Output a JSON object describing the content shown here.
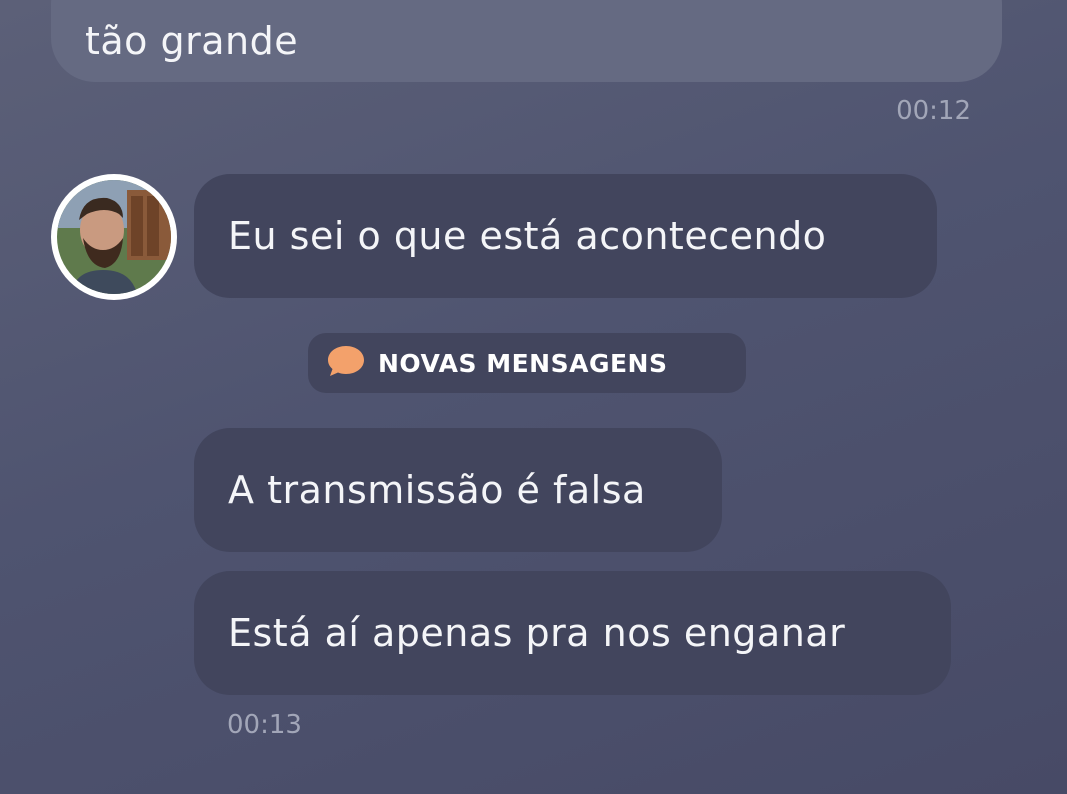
{
  "messages_top": {
    "text": "tão grande",
    "time": "00:12"
  },
  "contact": {
    "avatar_icon": "person-avatar"
  },
  "messages_in": [
    {
      "text": "Eu sei o que está acontecendo"
    },
    {
      "text": "A transmissão é falsa"
    },
    {
      "text": "Está aí apenas pra nos enganar"
    }
  ],
  "divider": {
    "label": "NOVAS MENSAGENS",
    "icon": "chat-bubble-icon",
    "icon_color": "#f3a16b"
  },
  "time_in": "00:13"
}
